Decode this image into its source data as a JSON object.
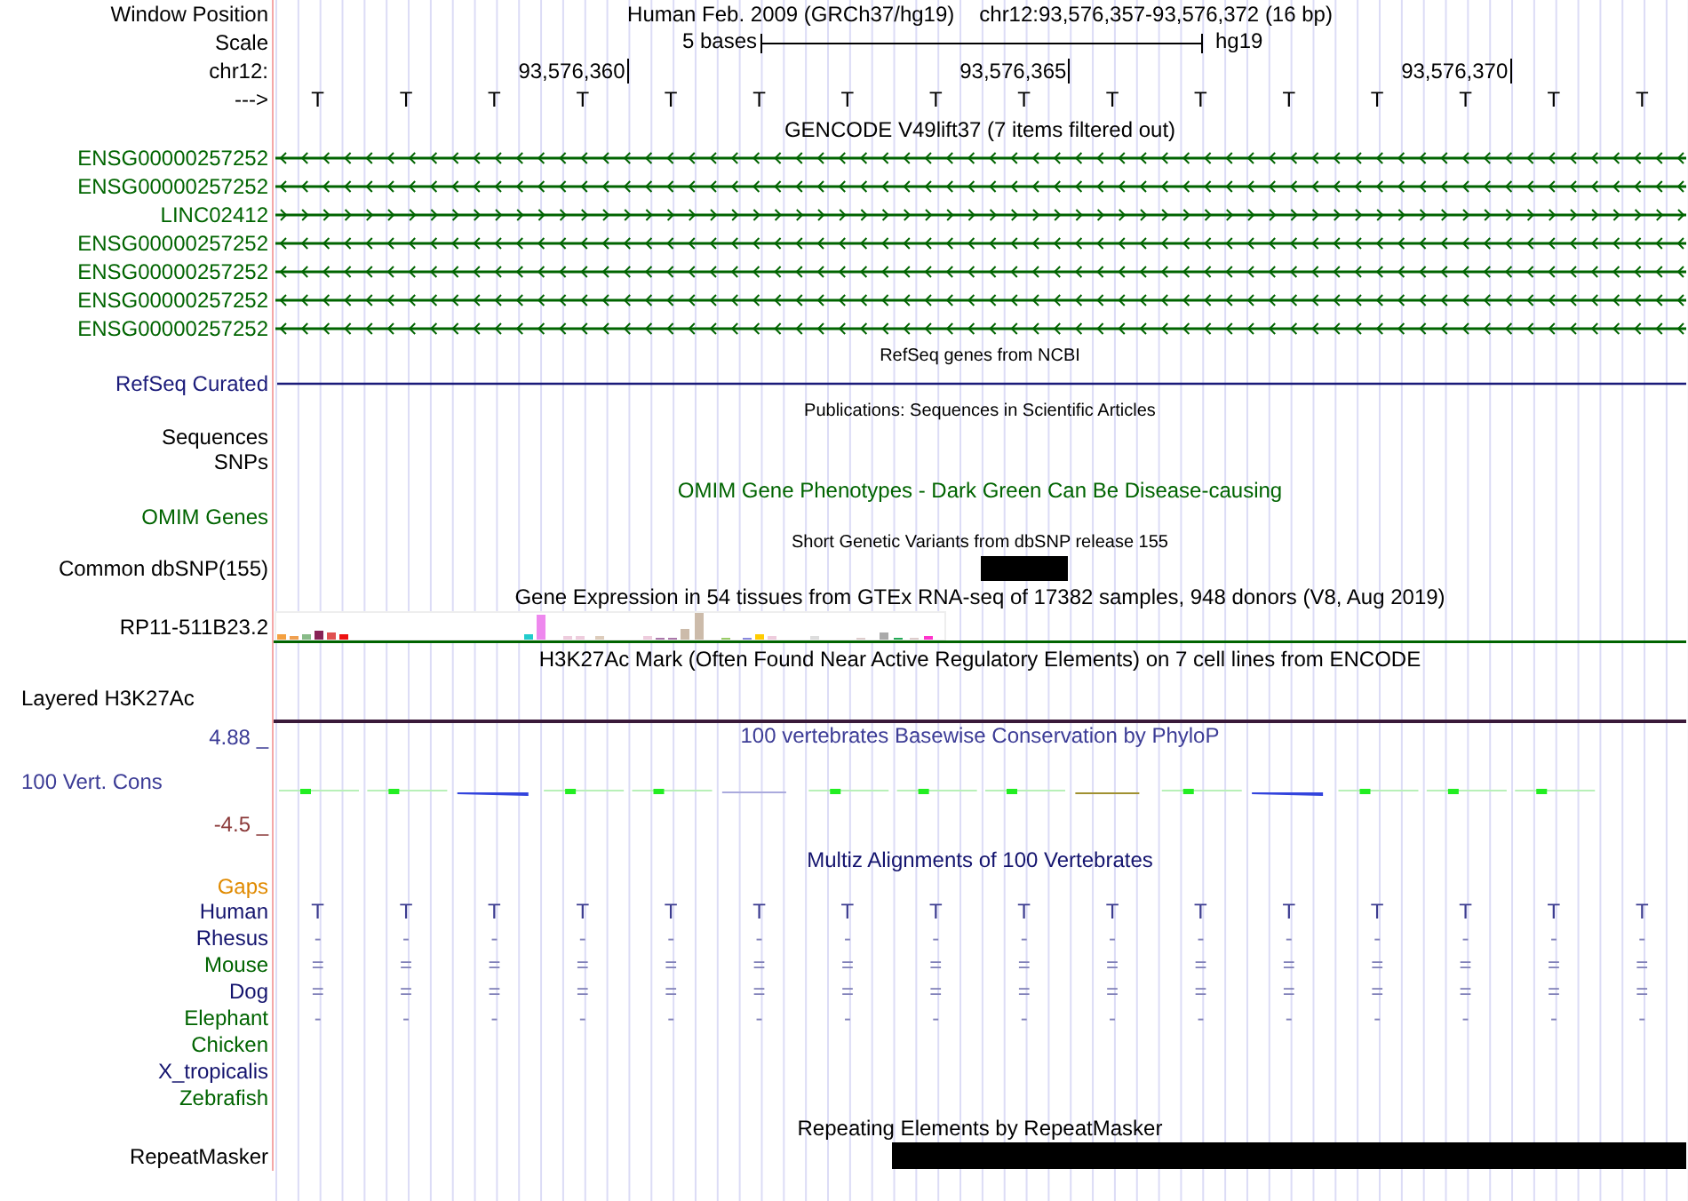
{
  "header": {
    "window_label": "Window Position",
    "assembly": "Human Feb. 2009 (GRCh37/hg19)",
    "position": "chr12:93,576,357-93,576,372 (16 bp)",
    "scale_label": "Scale",
    "scale_text": "5 bases",
    "scale_db": "hg19",
    "chrom_label": "chr12:",
    "ticks": [
      "93,576,360",
      "93,576,365",
      "93,576,370"
    ],
    "strand_label": "--->",
    "bases": [
      "T",
      "T",
      "T",
      "T",
      "T",
      "T",
      "T",
      "T",
      "T",
      "T",
      "T",
      "T",
      "T",
      "T",
      "T",
      "T"
    ]
  },
  "rows": [
    {
      "kind": "title",
      "text": "GENCODE V49lift37 (7 items filtered out)",
      "color": "#000000"
    },
    {
      "kind": "minus_gene",
      "label": "ENSG00000257252",
      "color": "#006400"
    },
    {
      "kind": "minus_gene",
      "label": "ENSG00000257252",
      "color": "#006400"
    },
    {
      "kind": "plus_gene",
      "label": "LINC02412",
      "color": "#006400"
    },
    {
      "kind": "minus_gene",
      "label": "ENSG00000257252",
      "color": "#006400"
    },
    {
      "kind": "minus_gene",
      "label": "ENSG00000257252",
      "color": "#006400"
    },
    {
      "kind": "minus_gene",
      "label": "ENSG00000257252",
      "color": "#006400"
    },
    {
      "kind": "minus_gene",
      "label": "ENSG00000257252",
      "color": "#006400"
    },
    {
      "kind": "small_title",
      "text": "RefSeq genes from NCBI",
      "color": "#000000"
    },
    {
      "kind": "line",
      "label": "RefSeq Curated",
      "color": "#1b1b7a"
    },
    {
      "kind": "small_title",
      "text": "Publications: Sequences in Scientific Articles",
      "color": "#000000"
    },
    {
      "kind": "label",
      "label": "Sequences",
      "color": "#000000"
    },
    {
      "kind": "label",
      "label": "SNPs",
      "color": "#000000"
    },
    {
      "kind": "title",
      "text": "OMIM Gene Phenotypes - Dark Green Can Be Disease-causing",
      "color": "#006400"
    },
    {
      "kind": "label",
      "label": "OMIM Genes",
      "color": "#006400"
    },
    {
      "kind": "small_title",
      "text": "Short Genetic Variants from dbSNP release 155",
      "color": "#000000"
    },
    {
      "kind": "snp_track",
      "label": "Common dbSNP(155)",
      "color": "#000000"
    },
    {
      "kind": "title",
      "text": "Gene Expression in 54 tissues from GTEx RNA-seq of 17382 samples, 948 donors (V8, Aug 2019)",
      "color": "#000000"
    },
    {
      "kind": "expression",
      "label": "RP11-511B23.2",
      "color": "#000000"
    },
    {
      "kind": "title",
      "text": "H3K27Ac Mark (Often Found Near Active Regulatory Elements) on 7 cell lines from ENCODE",
      "color": "#000000"
    },
    {
      "kind": "layered",
      "label": "Layered H3K27Ac",
      "color": "#000000"
    },
    {
      "kind": "conservation",
      "label": "100 Vert. Cons",
      "color": "#3c3c96",
      "max_label": "4.88 _",
      "min_label": "-4.5 _",
      "title": "100 vertebrates Basewise Conservation by PhyloP"
    },
    {
      "kind": "title",
      "text": "Multiz Alignments of 100 Vertebrates",
      "color": "#14146e"
    },
    {
      "kind": "label",
      "label": "Gaps",
      "color": "#e08a00"
    },
    {
      "kind": "species",
      "label": "Human",
      "color": "#14146e",
      "bases": [
        "T",
        "T",
        "T",
        "T",
        "T",
        "T",
        "T",
        "T",
        "T",
        "T",
        "T",
        "T",
        "T",
        "T",
        "T",
        "T"
      ]
    },
    {
      "kind": "species",
      "label": "Rhesus",
      "color": "#14146e",
      "bases": [
        "-",
        "-",
        "-",
        "-",
        "-",
        "-",
        "-",
        "-",
        "-",
        "-",
        "-",
        "-",
        "-",
        "-",
        "-",
        "-"
      ]
    },
    {
      "kind": "species",
      "label": "Mouse",
      "color": "#006400",
      "bases": [
        "=",
        "=",
        "=",
        "=",
        "=",
        "=",
        "=",
        "=",
        "=",
        "=",
        "=",
        "=",
        "=",
        "=",
        "=",
        "="
      ]
    },
    {
      "kind": "species",
      "label": "Dog",
      "color": "#14146e",
      "bases": [
        "=",
        "=",
        "=",
        "=",
        "=",
        "=",
        "=",
        "=",
        "=",
        "=",
        "=",
        "=",
        "=",
        "=",
        "=",
        "="
      ]
    },
    {
      "kind": "species",
      "label": "Elephant",
      "color": "#006400",
      "bases": [
        "-",
        "-",
        "-",
        "-",
        "-",
        "-",
        "-",
        "-",
        "-",
        "-",
        "-",
        "-",
        "-",
        "-",
        "-",
        "-"
      ]
    },
    {
      "kind": "species",
      "label": "Chicken",
      "color": "#006400"
    },
    {
      "kind": "species",
      "label": "X_tropicalis",
      "color": "#14146e"
    },
    {
      "kind": "species",
      "label": "Zebrafish",
      "color": "#006400"
    },
    {
      "kind": "title",
      "text": "Repeating Elements by RepeatMasker",
      "color": "#000000"
    },
    {
      "kind": "repeat_track",
      "label": "RepeatMasker",
      "color": "#000000"
    }
  ]
}
